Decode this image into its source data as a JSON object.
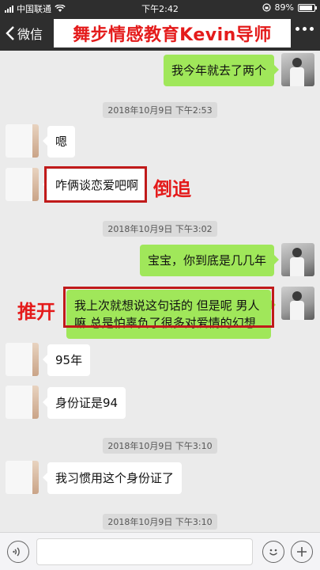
{
  "status_bar": {
    "carrier": "中国联通",
    "time": "下午2:42",
    "battery": "89%",
    "battery_level": 0.89
  },
  "nav": {
    "back_label": "微信",
    "title": "舞步情感教育Kevin导师"
  },
  "messages": [
    {
      "side": "out",
      "text": "我今年就去了两个"
    },
    {
      "timestamp": "2018年10月9日 下午2:53"
    },
    {
      "side": "in",
      "text": "嗯"
    },
    {
      "side": "in",
      "text": "咋俩谈恋爱吧啊",
      "annotation": "倒追"
    },
    {
      "timestamp": "2018年10月9日 下午3:02"
    },
    {
      "side": "out",
      "text": "宝宝，你到底是几几年"
    },
    {
      "side": "out",
      "text": "我上次就想说这句话的 但是呢 男人嘛 总是怕辜负了很多对爱情的幻想",
      "annotation": "推开"
    },
    {
      "side": "in",
      "text": "95年"
    },
    {
      "side": "in",
      "text": "身份证是94"
    },
    {
      "timestamp": "2018年10月9日 下午3:10"
    },
    {
      "side": "in",
      "text": "我习惯用这个身份证了"
    },
    {
      "timestamp": "2018年10月9日 下午3:10"
    }
  ]
}
